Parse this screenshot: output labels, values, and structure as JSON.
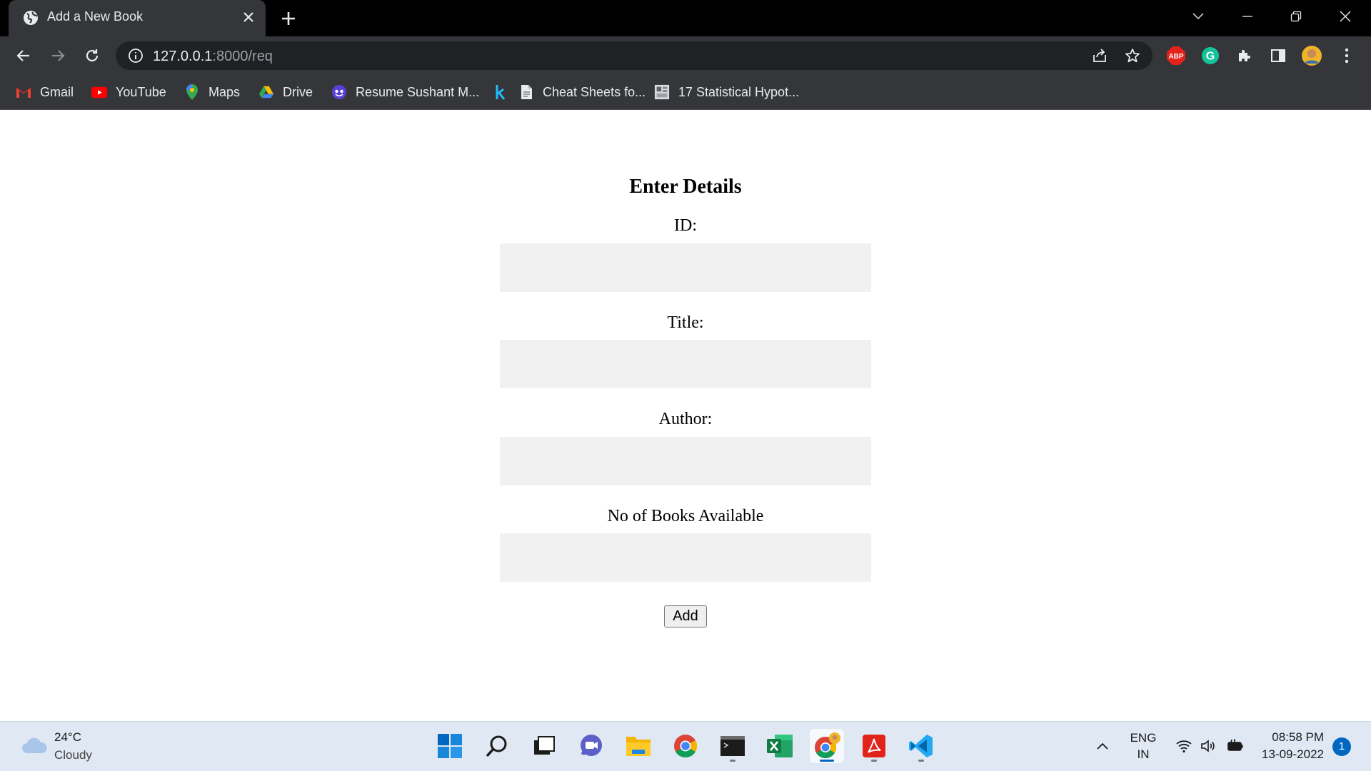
{
  "browser": {
    "tab_title": "Add a New Book",
    "url_host": "127.0.0.1",
    "url_rest": ":8000/req",
    "bookmarks": [
      {
        "label": "Gmail",
        "icon": "gmail-icon"
      },
      {
        "label": "YouTube",
        "icon": "youtube-icon"
      },
      {
        "label": "Maps",
        "icon": "maps-icon"
      },
      {
        "label": "Drive",
        "icon": "drive-icon"
      },
      {
        "label": "Resume Sushant M...",
        "icon": "resume-icon"
      },
      {
        "label": "",
        "icon": "k-icon"
      },
      {
        "label": "Cheat Sheets fo...",
        "icon": "document-icon"
      },
      {
        "label": "17 Statistical Hypot...",
        "icon": "image-icon"
      }
    ],
    "extensions": {
      "abp": "ABP",
      "grammarly": "G"
    }
  },
  "form": {
    "heading": "Enter Details",
    "fields": [
      {
        "label": "ID:",
        "value": ""
      },
      {
        "label": "Title:",
        "value": ""
      },
      {
        "label": "Author:",
        "value": ""
      },
      {
        "label": "No of Books Available",
        "value": ""
      }
    ],
    "submit_label": "Add"
  },
  "taskbar": {
    "weather_temp": "24°C",
    "weather_desc": "Cloudy",
    "lang_line1": "ENG",
    "lang_line2": "IN",
    "time": "08:58 PM",
    "date": "13-09-2022",
    "notification_count": "1",
    "colors": {
      "windows_blue": "#0067c0",
      "excel_green": "#107c41",
      "acrobat_red": "#e2231a",
      "vscode_blue": "#23a9f2"
    }
  }
}
